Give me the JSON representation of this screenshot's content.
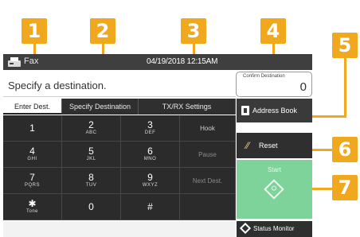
{
  "callouts": [
    "1",
    "2",
    "3",
    "4",
    "5",
    "6",
    "7"
  ],
  "status_bar": {
    "mode": "Fax",
    "datetime": "04/19/2018 12:15AM",
    "mode_icon": "fax-machine-icon"
  },
  "prompt": "Specify a destination.",
  "confirm_destination": {
    "label": "Confirm Destination",
    "count": "0"
  },
  "tabs": [
    {
      "label": "Enter Dest.",
      "active": true
    },
    {
      "label": "Specify Destination",
      "active": false
    },
    {
      "label": "TX/RX Settings",
      "active": false
    }
  ],
  "keypad": [
    {
      "num": "1",
      "sub": ""
    },
    {
      "num": "2",
      "sub": "ABC"
    },
    {
      "num": "3",
      "sub": "DEF"
    },
    {
      "num": "4",
      "sub": "GHI"
    },
    {
      "num": "5",
      "sub": "JKL"
    },
    {
      "num": "6",
      "sub": "MNO"
    },
    {
      "num": "7",
      "sub": "PQRS"
    },
    {
      "num": "8",
      "sub": "TUV"
    },
    {
      "num": "9",
      "sub": "WXYZ"
    },
    {
      "num": "✱",
      "sub": "Tone"
    },
    {
      "num": "0",
      "sub": ""
    },
    {
      "num": "#",
      "sub": ""
    }
  ],
  "function_keys": {
    "hook": "Hook",
    "pause": "Pause",
    "next_dest": "Next Dest."
  },
  "address_book": {
    "label": "Address Book",
    "icon": "address-book-icon"
  },
  "reset": {
    "label": "Reset",
    "icon": "reset-icon"
  },
  "start": {
    "label": "Start",
    "icon": "start-diamond-icon"
  },
  "status_monitor": {
    "label": "Status Monitor",
    "icon": "status-monitor-icon"
  },
  "colors": {
    "callout": "#f0a81e",
    "start": "#7ed39b",
    "dark": "#2b2b2b"
  }
}
